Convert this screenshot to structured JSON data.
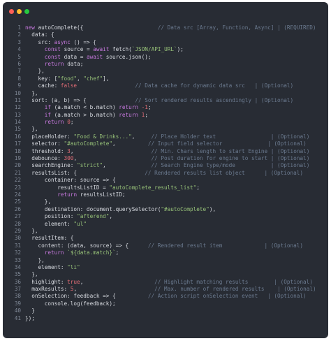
{
  "window": {
    "controls": {
      "close_color": "#ff5f56",
      "minimize_color": "#ffbd2e",
      "maximize_color": "#27c93f"
    }
  },
  "code": {
    "language": "javascript",
    "lines": [
      {
        "n": "1",
        "tokens": [
          [
            "kw",
            "new "
          ],
          [
            "plain",
            "autoComplete({"
          ],
          [
            "pad",
            "                       "
          ],
          [
            "cmt",
            "// Data src [Array, Function, Async] | (REQUIRED)"
          ]
        ]
      },
      {
        "n": "2",
        "tokens": [
          [
            "plain",
            "  data: {"
          ]
        ]
      },
      {
        "n": "3",
        "tokens": [
          [
            "plain",
            "    src: "
          ],
          [
            "kw",
            "async"
          ],
          [
            "plain",
            " () => {"
          ]
        ]
      },
      {
        "n": "4",
        "tokens": [
          [
            "plain",
            "      "
          ],
          [
            "kw",
            "const"
          ],
          [
            "plain",
            " source = "
          ],
          [
            "kw",
            "await"
          ],
          [
            "plain",
            " fetch("
          ],
          [
            "str",
            "`JSON/API_URL`"
          ],
          [
            "plain",
            ");"
          ]
        ]
      },
      {
        "n": "5",
        "tokens": [
          [
            "plain",
            "      "
          ],
          [
            "kw",
            "const"
          ],
          [
            "plain",
            " data = "
          ],
          [
            "kw",
            "await"
          ],
          [
            "plain",
            " source.json();"
          ]
        ]
      },
      {
        "n": "6",
        "tokens": [
          [
            "plain",
            "      "
          ],
          [
            "kw",
            "return"
          ],
          [
            "plain",
            " data;"
          ]
        ]
      },
      {
        "n": "7",
        "tokens": [
          [
            "plain",
            "    },"
          ]
        ]
      },
      {
        "n": "8",
        "tokens": [
          [
            "plain",
            "    key: ["
          ],
          [
            "str",
            "\"food\""
          ],
          [
            "plain",
            ", "
          ],
          [
            "str",
            "\"chef\""
          ],
          [
            "plain",
            "],"
          ]
        ]
      },
      {
        "n": "9",
        "tokens": [
          [
            "plain",
            "    cache: "
          ],
          [
            "num",
            "false"
          ],
          [
            "pad",
            "                  "
          ],
          [
            "cmt",
            "// Data cache for dynamic data src   | (Optional)"
          ]
        ]
      },
      {
        "n": "10",
        "tokens": [
          [
            "plain",
            "  },"
          ]
        ]
      },
      {
        "n": "11",
        "tokens": [
          [
            "plain",
            "  sort: (a, b) => {"
          ],
          [
            "pad",
            "               "
          ],
          [
            "cmt",
            "// Sort rendered results ascendingly | (Optional)"
          ]
        ]
      },
      {
        "n": "12",
        "tokens": [
          [
            "plain",
            "      "
          ],
          [
            "kw",
            "if"
          ],
          [
            "plain",
            " (a.match < b.match) "
          ],
          [
            "kw",
            "return"
          ],
          [
            "plain",
            " "
          ],
          [
            "num",
            "-1"
          ],
          [
            "plain",
            ";"
          ]
        ]
      },
      {
        "n": "13",
        "tokens": [
          [
            "plain",
            "      "
          ],
          [
            "kw",
            "if"
          ],
          [
            "plain",
            " (a.match > b.match) "
          ],
          [
            "kw",
            "return"
          ],
          [
            "plain",
            " "
          ],
          [
            "num",
            "1"
          ],
          [
            "plain",
            ";"
          ]
        ]
      },
      {
        "n": "14",
        "tokens": [
          [
            "plain",
            "      "
          ],
          [
            "kw",
            "return"
          ],
          [
            "plain",
            " "
          ],
          [
            "num",
            "0"
          ],
          [
            "plain",
            ";"
          ]
        ]
      },
      {
        "n": "15",
        "tokens": [
          [
            "plain",
            "  },"
          ]
        ]
      },
      {
        "n": "16",
        "tokens": [
          [
            "plain",
            "  placeHolder: "
          ],
          [
            "str",
            "\"Food & Drinks...\""
          ],
          [
            "plain",
            ","
          ],
          [
            "pad",
            "     "
          ],
          [
            "cmt",
            "// Place Holder text                 | (Optional)"
          ]
        ]
      },
      {
        "n": "17",
        "tokens": [
          [
            "plain",
            "  selector: "
          ],
          [
            "str",
            "\"#autoComplete\""
          ],
          [
            "plain",
            ","
          ],
          [
            "pad",
            "          "
          ],
          [
            "cmt",
            "// Input field selector              | (Optional)"
          ]
        ]
      },
      {
        "n": "18",
        "tokens": [
          [
            "plain",
            "  threshold: "
          ],
          [
            "num",
            "3"
          ],
          [
            "plain",
            ","
          ],
          [
            "pad",
            "                        "
          ],
          [
            "cmt",
            "// Min. Chars length to start Engine | (Optional)"
          ]
        ]
      },
      {
        "n": "19",
        "tokens": [
          [
            "plain",
            "  debounce: "
          ],
          [
            "num",
            "300"
          ],
          [
            "plain",
            ","
          ],
          [
            "pad",
            "                       "
          ],
          [
            "cmt",
            "// Post duration for engine to start | (Optional)"
          ]
        ]
      },
      {
        "n": "20",
        "tokens": [
          [
            "plain",
            "  searchEngine: "
          ],
          [
            "str",
            "\"strict\""
          ],
          [
            "plain",
            ","
          ],
          [
            "pad",
            "              "
          ],
          [
            "cmt",
            "// Search Engine type/mode           | (Optional)"
          ]
        ]
      },
      {
        "n": "21",
        "tokens": [
          [
            "plain",
            "  resultsList: {"
          ],
          [
            "pad",
            "                     "
          ],
          [
            "cmt",
            "// Rendered results list object      | (Optional)"
          ]
        ]
      },
      {
        "n": "22",
        "tokens": [
          [
            "plain",
            "      container: source => {"
          ]
        ]
      },
      {
        "n": "23",
        "tokens": [
          [
            "plain",
            "          resultsListID = "
          ],
          [
            "str",
            "\"autoComplete_results_list\""
          ],
          [
            "plain",
            ";"
          ]
        ]
      },
      {
        "n": "24",
        "tokens": [
          [
            "plain",
            "          "
          ],
          [
            "kw",
            "return"
          ],
          [
            "plain",
            " resultsListID;"
          ]
        ]
      },
      {
        "n": "25",
        "tokens": [
          [
            "plain",
            "      },"
          ]
        ]
      },
      {
        "n": "26",
        "tokens": [
          [
            "plain",
            "      destination: document.querySelector("
          ],
          [
            "str",
            "\"#autoComplete\""
          ],
          [
            "plain",
            "),"
          ]
        ]
      },
      {
        "n": "27",
        "tokens": [
          [
            "plain",
            "      position: "
          ],
          [
            "str",
            "\"afterend\""
          ],
          [
            "plain",
            ","
          ]
        ]
      },
      {
        "n": "28",
        "tokens": [
          [
            "plain",
            "      element: "
          ],
          [
            "str",
            "\"ul\""
          ]
        ]
      },
      {
        "n": "29",
        "tokens": [
          [
            "plain",
            "  },"
          ]
        ]
      },
      {
        "n": "30",
        "tokens": [
          [
            "plain",
            "  resultItem: {"
          ]
        ]
      },
      {
        "n": "31",
        "tokens": [
          [
            "plain",
            "    content: (data, source) => {"
          ],
          [
            "pad",
            "      "
          ],
          [
            "cmt",
            "// Rendered result item             | (Optional)"
          ]
        ]
      },
      {
        "n": "32",
        "tokens": [
          [
            "plain",
            "      "
          ],
          [
            "kw",
            "return"
          ],
          [
            "plain",
            " "
          ],
          [
            "str",
            "`${data.match}`"
          ],
          [
            "plain",
            ";"
          ]
        ]
      },
      {
        "n": "33",
        "tokens": [
          [
            "plain",
            "    },"
          ]
        ]
      },
      {
        "n": "34",
        "tokens": [
          [
            "plain",
            "    element: "
          ],
          [
            "str",
            "\"li\""
          ]
        ]
      },
      {
        "n": "35",
        "tokens": [
          [
            "plain",
            "  },"
          ]
        ]
      },
      {
        "n": "36",
        "tokens": [
          [
            "plain",
            "  highlight: "
          ],
          [
            "num",
            "true"
          ],
          [
            "plain",
            ","
          ],
          [
            "pad",
            "                      "
          ],
          [
            "cmt",
            "// Highlight matching results        | (Optional)"
          ]
        ]
      },
      {
        "n": "37",
        "tokens": [
          [
            "plain",
            "  maxResults: "
          ],
          [
            "num",
            "5"
          ],
          [
            "plain",
            ","
          ],
          [
            "pad",
            "                        "
          ],
          [
            "cmt",
            "// Max. number of rendered results    | (Optional)"
          ]
        ]
      },
      {
        "n": "38",
        "tokens": [
          [
            "plain",
            "  onSelection: feedback => {"
          ],
          [
            "pad",
            "          "
          ],
          [
            "cmt",
            "// Action script onSelection event   | (Optional)"
          ]
        ]
      },
      {
        "n": "39",
        "tokens": [
          [
            "plain",
            "      console.log(feedback);"
          ]
        ]
      },
      {
        "n": "40",
        "tokens": [
          [
            "plain",
            "  }"
          ]
        ]
      },
      {
        "n": "41",
        "tokens": [
          [
            "plain",
            "});"
          ]
        ]
      }
    ]
  }
}
